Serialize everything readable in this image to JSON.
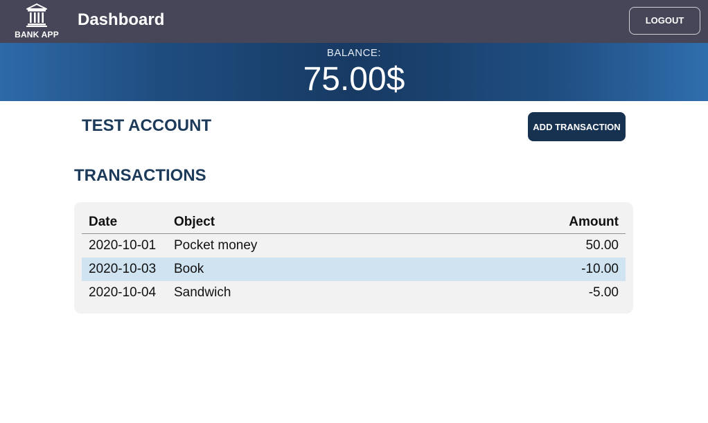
{
  "header": {
    "logo_text": "BANK APP",
    "title": "Dashboard",
    "logout_label": "LOGOUT"
  },
  "balance": {
    "label": "BALANCE:",
    "value": "75.00",
    "currency": "$"
  },
  "account": {
    "name": "TEST ACCOUNT",
    "add_transaction_label": "ADD TRANSACTION"
  },
  "transactions": {
    "heading": "TRANSACTIONS",
    "columns": [
      "Date",
      "Object",
      "Amount"
    ],
    "rows": [
      {
        "date": "2020-10-01",
        "object": "Pocket money",
        "amount": "50.00"
      },
      {
        "date": "2020-10-03",
        "object": "Book",
        "amount": "-10.00"
      },
      {
        "date": "2020-10-04",
        "object": "Sandwich",
        "amount": "-5.00"
      }
    ]
  },
  "colors": {
    "topbar": "#464658",
    "primary_dark": "#163250",
    "heading_text": "#1c3a59",
    "row_highlight": "#cfe3f0",
    "panel_bg": "#f2f2f2"
  },
  "icons": {
    "logo": "bank-building-icon"
  }
}
